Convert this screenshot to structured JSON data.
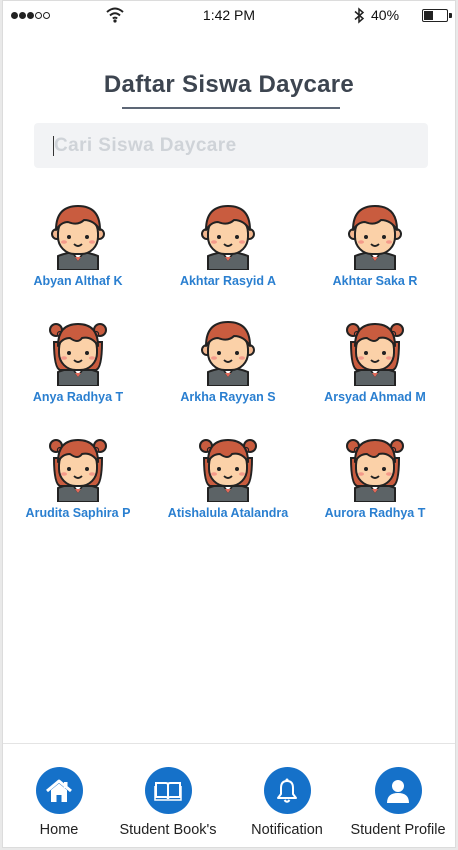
{
  "status_bar": {
    "time": "1:42 PM",
    "battery": "40%",
    "battery_level": 0.4
  },
  "header": {
    "title": "Daftar Siswa Daycare"
  },
  "search": {
    "placeholder": "Cari Siswa Daycare",
    "value": ""
  },
  "students": [
    {
      "name": "Abyan Althaf K",
      "avatar": "boy-avatar-icon"
    },
    {
      "name": "Akhtar Rasyid A",
      "avatar": "boy-avatar-icon"
    },
    {
      "name": "Akhtar Saka R",
      "avatar": "boy-avatar-icon"
    },
    {
      "name": "Anya Radhya T",
      "avatar": "girl-avatar-icon"
    },
    {
      "name": "Arkha Rayyan S",
      "avatar": "boy-avatar-icon"
    },
    {
      "name": "Arsyad Ahmad M",
      "avatar": "girl-avatar-icon"
    },
    {
      "name": "Arudita Saphira P",
      "avatar": "girl-avatar-icon"
    },
    {
      "name": "Atishalula Atalandra",
      "avatar": "girl-avatar-icon"
    },
    {
      "name": "Aurora Radhya T",
      "avatar": "girl-avatar-icon"
    }
  ],
  "nav": {
    "items": [
      {
        "label": "Home",
        "icon": "home-icon"
      },
      {
        "label": "Student Book's",
        "icon": "book-icon"
      },
      {
        "label": "Notification",
        "icon": "bell-icon"
      },
      {
        "label": "Student Profile",
        "icon": "user-icon"
      }
    ]
  },
  "colors": {
    "accent": "#1571c9",
    "link": "#2a7fd0",
    "title": "#3d4550"
  }
}
